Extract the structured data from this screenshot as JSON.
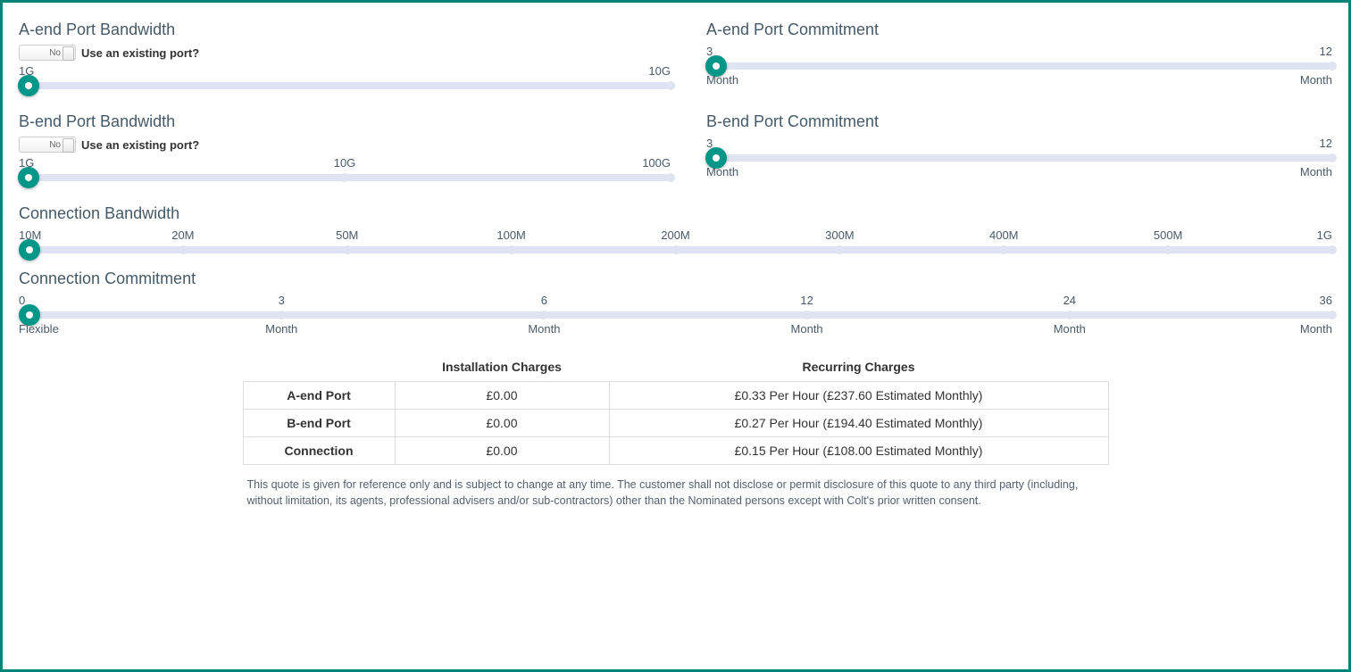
{
  "colors": {
    "accent": "#009688"
  },
  "aEndBandwidth": {
    "title": "A-end Port Bandwidth",
    "toggleText": "No",
    "toggleLabel": "Use an existing port?",
    "ticks": [
      "1G",
      "10G"
    ]
  },
  "aEndCommitment": {
    "title": "A-end Port Commitment",
    "ticks": [
      "3",
      "12"
    ],
    "sub": [
      "Month",
      "Month"
    ]
  },
  "bEndBandwidth": {
    "title": "B-end Port Bandwidth",
    "toggleText": "No",
    "toggleLabel": "Use an existing port?",
    "ticks": [
      "1G",
      "10G",
      "100G"
    ]
  },
  "bEndCommitment": {
    "title": "B-end Port Commitment",
    "ticks": [
      "3",
      "12"
    ],
    "sub": [
      "Month",
      "Month"
    ]
  },
  "connBandwidth": {
    "title": "Connection Bandwidth",
    "ticks": [
      "10M",
      "20M",
      "50M",
      "100M",
      "200M",
      "300M",
      "400M",
      "500M",
      "1G"
    ]
  },
  "connCommitment": {
    "title": "Connection Commitment",
    "ticks": [
      "0",
      "3",
      "6",
      "12",
      "24",
      "36"
    ],
    "sub": [
      "Flexible",
      "Month",
      "Month",
      "Month",
      "Month",
      "Month"
    ]
  },
  "charges": {
    "headers": {
      "install": "Installation Charges",
      "recurring": "Recurring Charges"
    },
    "rows": [
      {
        "label": "A-end Port",
        "install": "£0.00",
        "recurring": "£0.33 Per Hour (£237.60 Estimated Monthly)"
      },
      {
        "label": "B-end Port",
        "install": "£0.00",
        "recurring": "£0.27 Per Hour (£194.40 Estimated Monthly)"
      },
      {
        "label": "Connection",
        "install": "£0.00",
        "recurring": "£0.15 Per Hour (£108.00 Estimated Monthly)"
      }
    ]
  },
  "disclaimer": "This quote is given for reference only and is subject to change at any time. The customer shall not disclose or permit disclosure of this quote to any third party (including, without limitation, its agents, professional advisers and/or sub-contractors) other than the Nominated persons except with Colt's prior written consent."
}
